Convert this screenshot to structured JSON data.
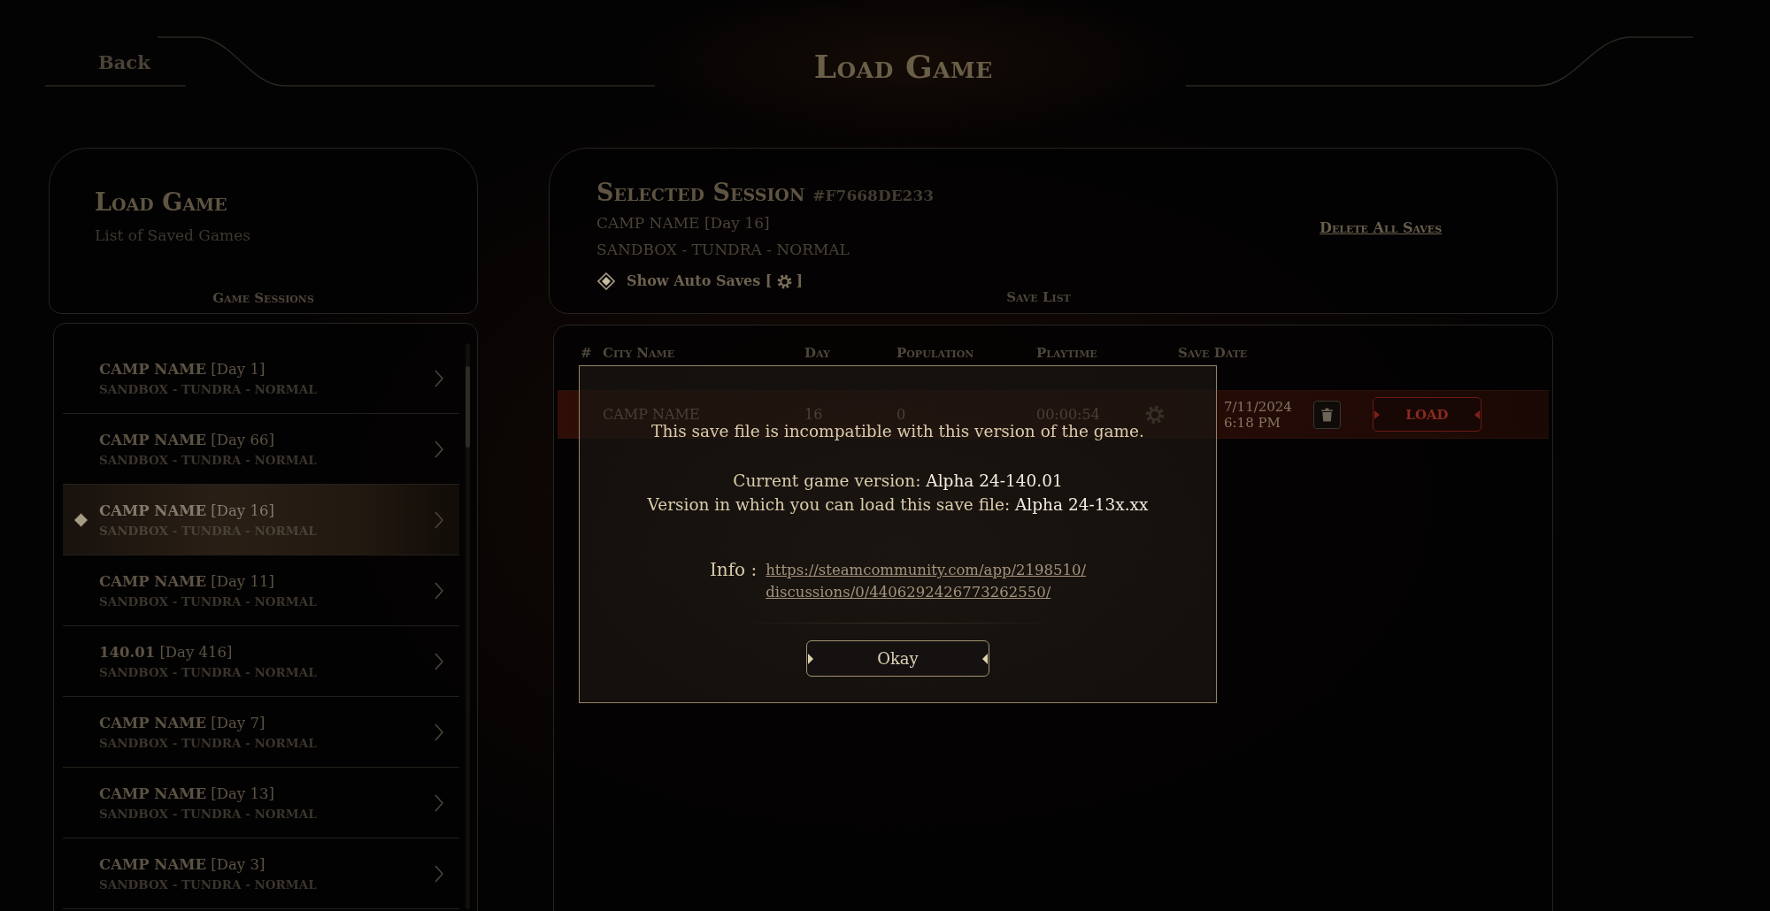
{
  "header": {
    "back": "Back",
    "title": "Load Game"
  },
  "sessions_panel": {
    "title": "Load Game",
    "subtitle": "List of Saved Games",
    "section": "Game Sessions",
    "sessions": [
      {
        "title": "**CAMP NAME** [Day 1]",
        "mode": "SANDBOX - TUNDRA - NORMAL",
        "selected": false
      },
      {
        "title": "**CAMP NAME** [Day 66]",
        "mode": "SANDBOX - TUNDRA - NORMAL",
        "selected": false
      },
      {
        "title": "**CAMP NAME** [Day 16]",
        "mode": "SANDBOX - TUNDRA - NORMAL",
        "selected": true
      },
      {
        "title": "**CAMP NAME** [Day 11]",
        "mode": "SANDBOX - TUNDRA - NORMAL",
        "selected": false
      },
      {
        "title": "**140.01** [Day 416]",
        "mode": "SANDBOX - TUNDRA - NORMAL",
        "selected": false
      },
      {
        "title": "**CAMP NAME** [Day 7]",
        "mode": "SANDBOX - TUNDRA - NORMAL",
        "selected": false
      },
      {
        "title": "**CAMP NAME** [Day 13]",
        "mode": "SANDBOX - TUNDRA - NORMAL",
        "selected": false
      },
      {
        "title": "**CAMP NAME** [Day 3]",
        "mode": "SANDBOX - TUNDRA - NORMAL",
        "selected": false
      }
    ]
  },
  "session_panel": {
    "title": "Selected Session",
    "session_id": "#F7668DE233",
    "camp": "CAMP NAME [Day 16]",
    "mode": "SANDBOX - TUNDRA - NORMAL",
    "auto_saves": {
      "label": "Show Auto Saves [",
      "label_end": "]",
      "checked": true
    },
    "delete_all": "Delete All Saves",
    "section": "Save List"
  },
  "save_table": {
    "columns": [
      "#",
      "City Name",
      "Day",
      "Population",
      "Playtime",
      "Save Date"
    ],
    "rows": [
      {
        "city": "CAMP NAME",
        "day": "16",
        "population": "0",
        "playtime": "00:00:54",
        "auto_save": true,
        "date": "7/11/2024",
        "time": "6:18 PM",
        "selected": true,
        "action": "LOAD"
      }
    ]
  },
  "dialog": {
    "message": "This save file is incompatible with this version of the game.",
    "versions": [
      {
        "label": "Current game version:",
        "value": "Alpha 24-140.01"
      },
      {
        "label": "Version in which you can load this save file:",
        "value": "Alpha 24-13x.xx"
      }
    ],
    "info_label": "Info :",
    "link_lines": [
      "https://steamcommunity.com/app/2198510/",
      "discussions/0/4406292426773262550/"
    ],
    "button": "Okay"
  }
}
